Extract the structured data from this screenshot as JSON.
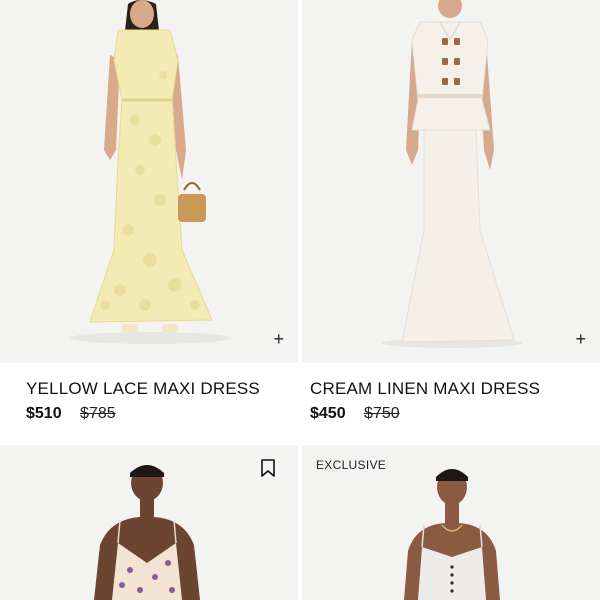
{
  "products": [
    {
      "name": "YELLOW LACE MAXI DRESS",
      "price": "$510",
      "original_price": "$785",
      "add_icon": "+",
      "image_alt": "model-in-yellow-lace-maxi-dress"
    },
    {
      "name": "CREAM LINEN MAXI DRESS",
      "price": "$450",
      "original_price": "$750",
      "add_icon": "+",
      "image_alt": "model-in-cream-linen-maxi-dress"
    },
    {
      "wishlist_icon": "bookmark-icon",
      "image_alt": "model-in-floral-slip-dress"
    },
    {
      "badge": "EXCLUSIVE",
      "image_alt": "model-in-white-corset-dress"
    }
  ],
  "colors": {
    "image_bg": "#f2f2f2",
    "text": "#111111"
  }
}
